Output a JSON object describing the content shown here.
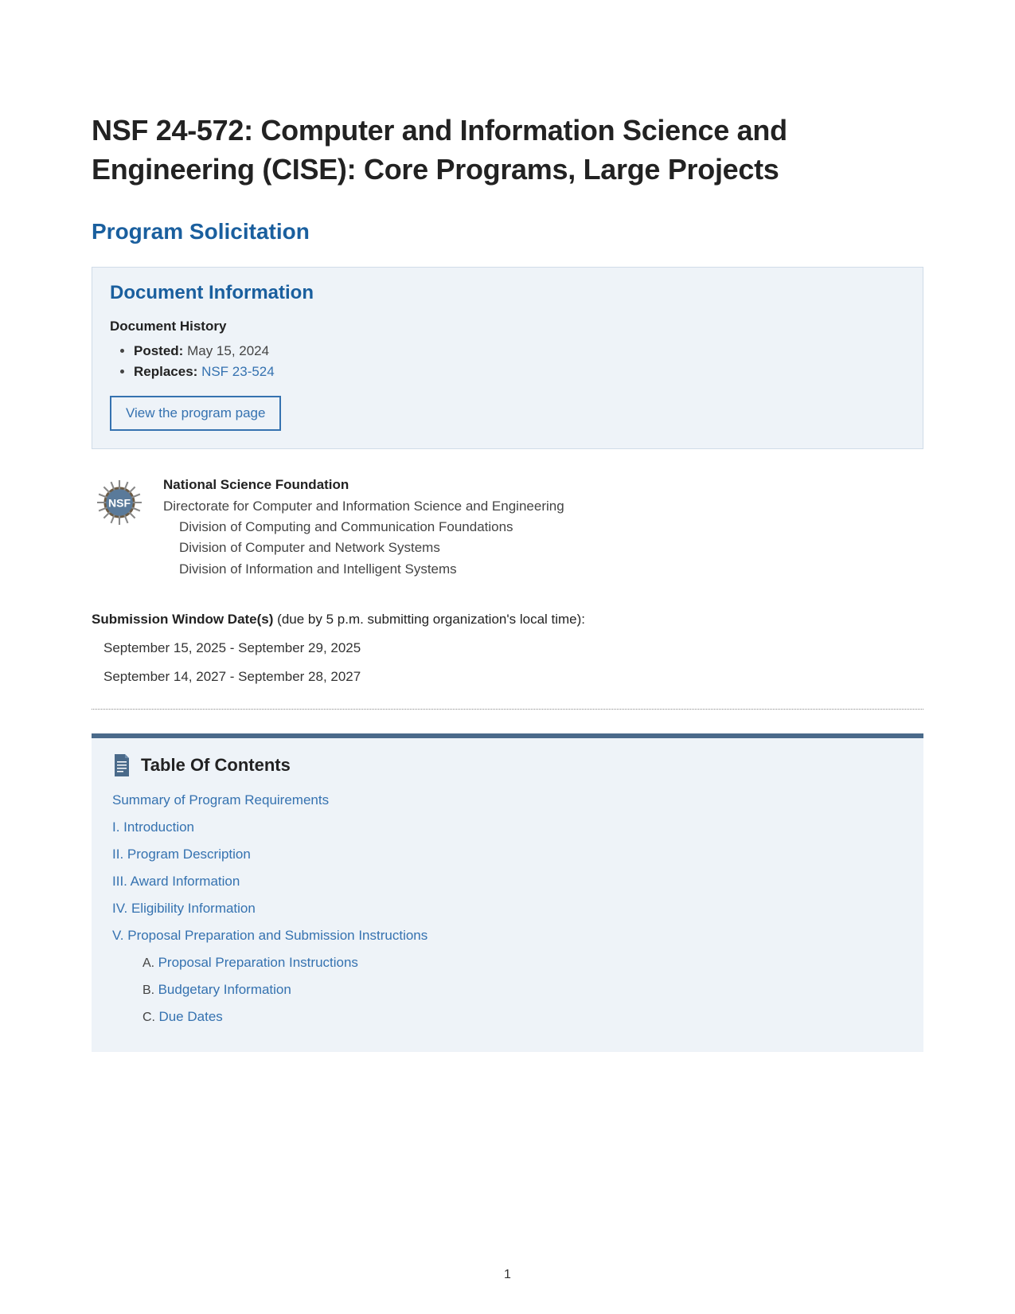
{
  "title": "NSF 24-572: Computer and Information Science and Engineering (CISE): Core Programs, Large Projects",
  "subtitle": "Program Solicitation",
  "docinfo": {
    "heading": "Document Information",
    "history_heading": "Document History",
    "posted_label": "Posted:",
    "posted_value": "May 15, 2024",
    "replaces_label": "Replaces:",
    "replaces_value": "NSF 23-524",
    "button": "View the program page"
  },
  "org": {
    "name": "National Science Foundation",
    "directorate": "Directorate for Computer and Information Science and Engineering",
    "divisions": [
      "Division of Computing and Communication Foundations",
      "Division of Computer and Network Systems",
      "Division of Information and Intelligent Systems"
    ]
  },
  "submission": {
    "label": "Submission Window Date(s)",
    "note": "(due by 5 p.m. submitting organization's local time):",
    "windows": [
      "September 15, 2025 - September 29, 2025",
      "September 14, 2027 - September 28, 2027"
    ]
  },
  "toc": {
    "heading": "Table Of Contents",
    "items": [
      "Summary of Program Requirements",
      "I. Introduction",
      "II. Program Description",
      "III. Award Information",
      "IV. Eligibility Information",
      "V. Proposal Preparation and Submission Instructions"
    ],
    "sub": [
      {
        "prefix": "A.",
        "text": "Proposal Preparation Instructions"
      },
      {
        "prefix": "B.",
        "text": "Budgetary Information"
      },
      {
        "prefix": "C.",
        "text": "Due Dates"
      }
    ]
  },
  "page_number": "1"
}
